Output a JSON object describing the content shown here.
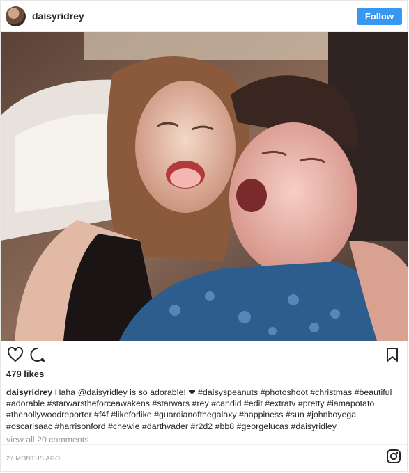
{
  "header": {
    "username": "daisyridrey",
    "follow_label": "Follow"
  },
  "photo": {
    "alt": "selfie photo"
  },
  "actions": {
    "like_icon": "heart-icon",
    "comment_icon": "comment-icon",
    "save_icon": "bookmark-icon"
  },
  "likes": "479 likes",
  "caption": {
    "username": "daisyridrey",
    "text": " Haha @daisyridley is so adorable! ❤ #daisyspeanuts #photoshoot #christmas #beautiful #adorable #starwarstheforceawakens #starwars #rey #candid #edit #extratv #pretty #iamapotato #thehollywoodreporter #f4f #likeforlike #guardianofthegalaxy #happiness #sun #johnboyega #oscarisaac #harrisonford #chewie #darthvader #r2d2 #bb8 #georgelucas #daisyridley"
  },
  "comments_link": "view all 20 comments",
  "footer": {
    "timestamp": "27 MONTHS AGO",
    "brand_icon": "instagram-icon"
  },
  "colors": {
    "follow_bg": "#3897f0",
    "text": "#262626",
    "muted": "#999999"
  }
}
